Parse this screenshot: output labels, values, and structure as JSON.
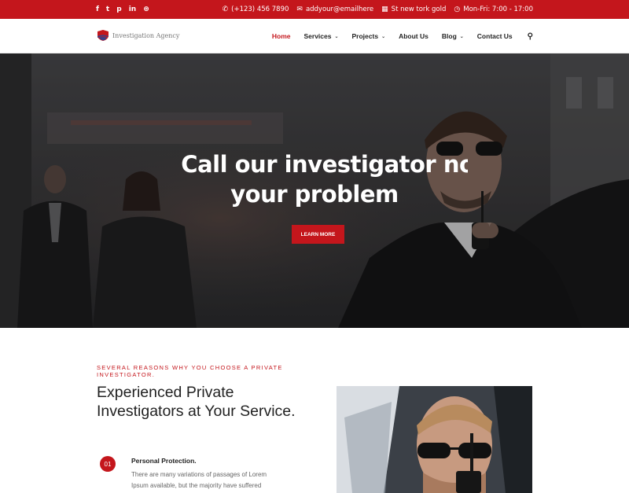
{
  "topbar": {
    "social": [
      {
        "icon": "facebook-icon",
        "glyph": "f"
      },
      {
        "icon": "twitter-icon",
        "glyph": "t"
      },
      {
        "icon": "pinterest-icon",
        "glyph": "p"
      },
      {
        "icon": "linkedin-icon",
        "glyph": "in"
      },
      {
        "icon": "dribbble-icon",
        "glyph": "⊛"
      }
    ],
    "phone": "(+123) 456 7890",
    "email": "addyour@emailhere",
    "address": "St new tork gold",
    "hours": "Mon-Fri: 7:00 - 17:00"
  },
  "nav": {
    "logo_text": "Investigation Agency",
    "items": [
      {
        "label": "Home",
        "active": true,
        "dropdown": false
      },
      {
        "label": "Services",
        "active": false,
        "dropdown": true
      },
      {
        "label": "Projects",
        "active": false,
        "dropdown": true
      },
      {
        "label": "About Us",
        "active": false,
        "dropdown": false
      },
      {
        "label": "Blog",
        "active": false,
        "dropdown": true
      },
      {
        "label": "Contact Us",
        "active": false,
        "dropdown": false
      }
    ]
  },
  "hero": {
    "title_line1": "Call our investigator now",
    "title_line2": "your problem",
    "button_label": "LEARN MORE"
  },
  "about": {
    "kicker": "SEVERAL REASONS WHY YOU CHOOSE A PRIVATE INVESTIGATOR.",
    "heading": "Experienced Private Investigators at Your Service.",
    "features": [
      {
        "number": "01",
        "title": "Personal Protection.",
        "text": "There are many variations of passages of Lorem Ipsum available, but the majority have suffered"
      }
    ]
  },
  "colors": {
    "accent": "#c4161c",
    "text_dark": "#222222",
    "text_muted": "#666666"
  }
}
